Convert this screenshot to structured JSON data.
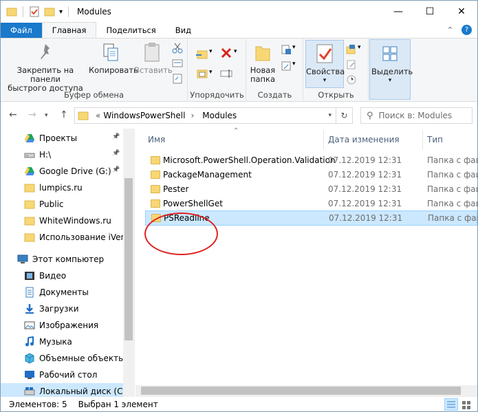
{
  "window": {
    "title": "Modules"
  },
  "tabs": {
    "file": "Файл",
    "home": "Главная",
    "share": "Поделиться",
    "view": "Вид"
  },
  "ribbon": {
    "pin": "Закрепить на панели быстрого доступа",
    "pin_l1": "Закрепить на панели",
    "pin_l2": "быстрого доступа",
    "copy": "Копировать",
    "paste": "Вставить",
    "clipboard": "Буфер обмена",
    "organize": "Упорядочить",
    "new_folder_l1": "Новая",
    "new_folder_l2": "папка",
    "create": "Создать",
    "properties": "Свойства",
    "open": "Открыть",
    "select": "Выделить"
  },
  "address": {
    "prefix": "«",
    "crumbs": [
      "WindowsPowerShell",
      "Modules"
    ],
    "search_placeholder": "Поиск в: Modules"
  },
  "sidebar": {
    "items": [
      {
        "label": "Проекты",
        "icon": "google-drive-folder-icon",
        "pinned": true
      },
      {
        "label": "H:\\",
        "icon": "drive-icon",
        "pinned": true
      },
      {
        "label": "Google Drive (G:)",
        "icon": "google-drive-icon",
        "pinned": true
      },
      {
        "label": "lumpics.ru",
        "icon": "folder-icon"
      },
      {
        "label": "Public",
        "icon": "folder-icon"
      },
      {
        "label": "WhiteWindows.ru",
        "icon": "folder-icon"
      },
      {
        "label": "Использование iVentoy",
        "icon": "folder-icon"
      },
      {
        "label": "Этот компьютер",
        "icon": "computer-icon"
      },
      {
        "label": "Видео",
        "icon": "video-icon"
      },
      {
        "label": "Документы",
        "icon": "documents-icon"
      },
      {
        "label": "Загрузки",
        "icon": "downloads-icon"
      },
      {
        "label": "Изображения",
        "icon": "pictures-icon"
      },
      {
        "label": "Музыка",
        "icon": "music-icon"
      },
      {
        "label": "Объемные объекты",
        "icon": "3d-objects-icon"
      },
      {
        "label": "Рабочий стол",
        "icon": "desktop-icon"
      },
      {
        "label": "Локальный диск (C:)",
        "icon": "local-disk-icon"
      }
    ]
  },
  "columns": {
    "name": "Имя",
    "date": "Дата изменения",
    "type": "Тип"
  },
  "files": [
    {
      "name": "Microsoft.PowerShell.Operation.Validation",
      "date": "07.12.2019 12:31",
      "type": "Папка с файлами"
    },
    {
      "name": "PackageManagement",
      "date": "07.12.2019 12:31",
      "type": "Папка с файлами"
    },
    {
      "name": "Pester",
      "date": "07.12.2019 12:31",
      "type": "Папка с файлами"
    },
    {
      "name": "PowerShellGet",
      "date": "07.12.2019 12:31",
      "type": "Папка с файлами"
    },
    {
      "name": "PSReadline",
      "date": "07.12.2019 12:31",
      "type": "Папка с файлами"
    }
  ],
  "status": {
    "count": "Элементов: 5",
    "selected": "Выбран 1 элемент"
  },
  "colors": {
    "accent": "#1979ca",
    "selection": "#cce8ff",
    "highlight_ellipse": "#e02020"
  }
}
